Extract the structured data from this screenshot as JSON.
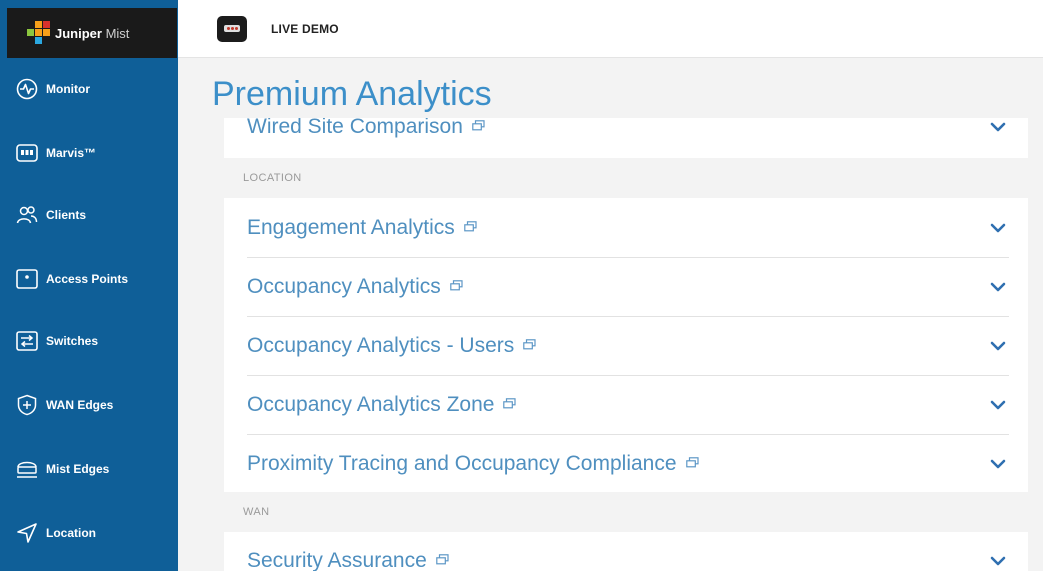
{
  "brand": {
    "name_bold": "Juniper",
    "name_thin": "Mist"
  },
  "header": {
    "org_name": "LIVE DEMO"
  },
  "sidebar": {
    "items": [
      {
        "label": "Monitor",
        "icon": "monitor-icon"
      },
      {
        "label": "Marvis™",
        "icon": "marvis-icon"
      },
      {
        "label": "Clients",
        "icon": "clients-icon"
      },
      {
        "label": "Access Points",
        "icon": "access-points-icon"
      },
      {
        "label": "Switches",
        "icon": "switches-icon"
      },
      {
        "label": "WAN Edges",
        "icon": "wan-edges-icon"
      },
      {
        "label": "Mist Edges",
        "icon": "mist-edges-icon"
      },
      {
        "label": "Location",
        "icon": "location-icon"
      }
    ]
  },
  "main": {
    "title": "Premium Analytics",
    "rows": [
      {
        "label": "Wired Site Comparison"
      },
      {
        "label": "Engagement Analytics"
      },
      {
        "label": "Occupancy Analytics"
      },
      {
        "label": "Occupancy Analytics - Users"
      },
      {
        "label": "Occupancy Analytics Zone"
      },
      {
        "label": "Proximity Tracing and Occupancy Compliance"
      },
      {
        "label": "Security Assurance"
      }
    ],
    "sections": [
      {
        "label": "LOCATION"
      },
      {
        "label": "WAN"
      }
    ]
  },
  "colors": {
    "sidebar": "#0f5f98",
    "accent": "#3c8fc9",
    "row_text": "#4f8fbf",
    "chevron": "#2f6fb0"
  }
}
